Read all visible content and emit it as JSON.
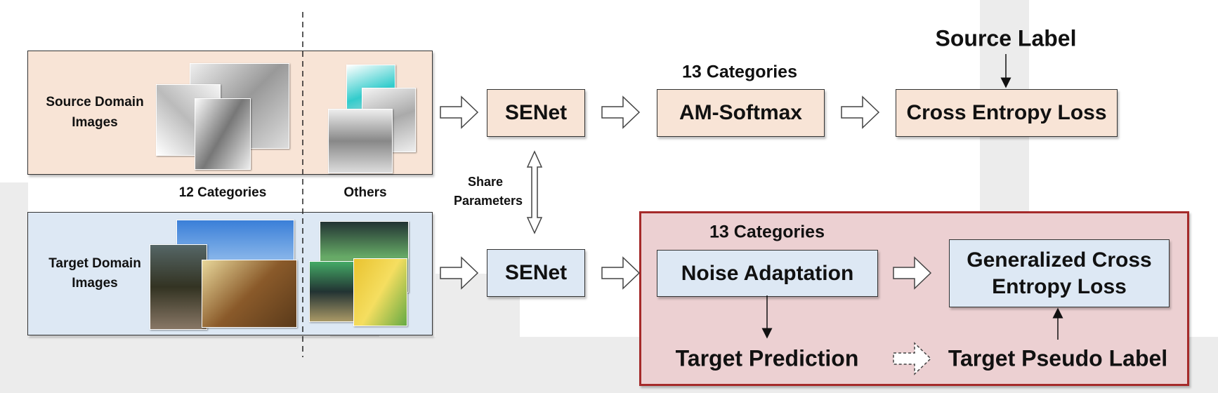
{
  "source_panel": {
    "label": "Source Domain Images"
  },
  "target_panel": {
    "label": "Target Domain Images"
  },
  "split_labels": {
    "known": "12 Categories",
    "others": "Others"
  },
  "share": {
    "label": "Share Parameters"
  },
  "top_row": {
    "senet": "SENet",
    "categories": "13 Categories",
    "am_softmax": "AM-Softmax",
    "loss": "Cross Entropy Loss",
    "source_label": "Source Label"
  },
  "bottom_row": {
    "senet": "SENet",
    "categories": "13 Categories",
    "noise": "Noise Adaptation",
    "gce": "Generalized Cross Entropy Loss",
    "prediction": "Target Prediction",
    "pseudo": "Target Pseudo Label"
  },
  "colors": {
    "peach": "#f8e4d6",
    "blue": "#dde8f4",
    "red_panel": "#ecd0d2",
    "red_border": "#a52a2a"
  }
}
